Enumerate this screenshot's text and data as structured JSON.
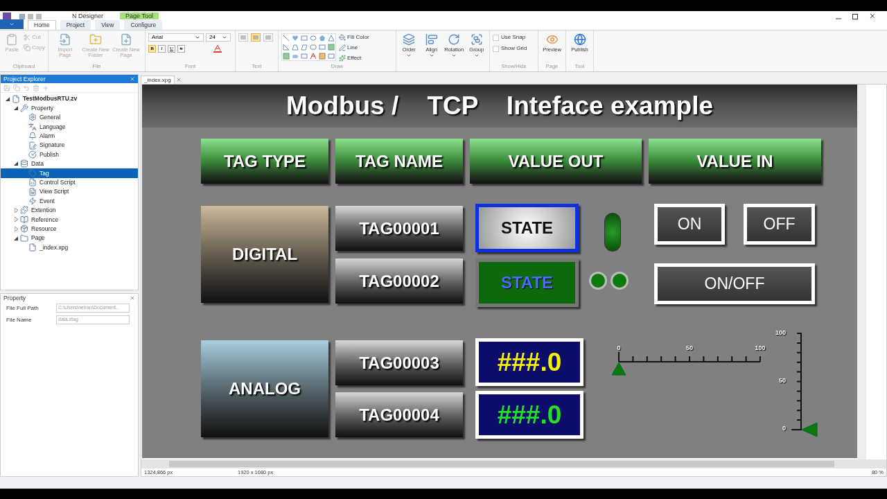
{
  "titlebar": {
    "app_title": "N Designer",
    "context_tab": "Page Tool"
  },
  "ribbon_tabs": [
    {
      "label": "Home",
      "selected": true
    },
    {
      "label": "Project",
      "selected": false
    },
    {
      "label": "View",
      "selected": false
    },
    {
      "label": "Configure",
      "selected": false
    }
  ],
  "ribbon": {
    "clipboard": {
      "label": "Clipboard",
      "paste": "Paste",
      "cut": "Cut",
      "copy": "Copy"
    },
    "file": {
      "label": "File",
      "buttons": [
        "Import Page",
        "Create New Folder",
        "Create New Page"
      ]
    },
    "font": {
      "label": "Font",
      "family": "Arial",
      "size": "24",
      "styles": [
        {
          "label": "B",
          "kind": "bold",
          "on": true
        },
        {
          "label": "I",
          "kind": "italic",
          "on": false
        },
        {
          "label": "U",
          "kind": "underline",
          "on": false
        },
        {
          "label": "S",
          "kind": "strike",
          "on": false
        }
      ]
    },
    "text": {
      "label": "Text",
      "alignments": [
        {
          "selected": false
        },
        {
          "selected": true
        },
        {
          "selected": false
        }
      ]
    },
    "draw": {
      "label": "Draw",
      "fill_color": "Fill Color",
      "line": "Line",
      "effect": "Effect"
    },
    "arrange": {
      "buttons": [
        "Order",
        "Align",
        "Rotation",
        "Group"
      ]
    },
    "show_hide": {
      "label": "Show/Hide",
      "options": [
        {
          "label": "Use Snap",
          "checked": false
        },
        {
          "label": "Show Grid",
          "checked": false
        }
      ]
    },
    "page": {
      "label": "Page",
      "button": "Preview"
    },
    "tool": {
      "label": "Tool",
      "button": "Publish"
    }
  },
  "project_explorer": {
    "title": "Project Explorer",
    "tree": [
      {
        "label": "TestModbusRTU.zv",
        "expanded": true,
        "selected": false,
        "children": [
          {
            "label": "Property",
            "expanded": true,
            "selected": false,
            "children": [
              {
                "label": "General",
                "selected": false
              },
              {
                "label": "Language",
                "selected": false
              },
              {
                "label": "Alarm",
                "selected": false
              },
              {
                "label": "Signature",
                "selected": false
              },
              {
                "label": "Publish",
                "selected": false
              }
            ]
          },
          {
            "label": "Data",
            "expanded": true,
            "selected": false,
            "children": [
              {
                "label": "Tag",
                "selected": true
              },
              {
                "label": "Control Script",
                "selected": false
              },
              {
                "label": "View Script",
                "selected": false
              },
              {
                "label": "Event",
                "selected": false
              }
            ]
          },
          {
            "label": "Extention",
            "expanded": false,
            "selected": false
          },
          {
            "label": "Reference",
            "expanded": false,
            "selected": false
          },
          {
            "label": "Resource",
            "expanded": false,
            "selected": false
          },
          {
            "label": "Page",
            "expanded": true,
            "selected": false,
            "children": [
              {
                "label": "_index.xpg",
                "selected": false
              }
            ]
          }
        ]
      }
    ]
  },
  "property_panel": {
    "title": "Property",
    "fields": [
      {
        "label": "File Full Path",
        "value": "C:\\Users\\netran\\Document...",
        "disabled": true
      },
      {
        "label": "File Name",
        "value": "data.ztag",
        "disabled": true
      }
    ]
  },
  "document_tab": "_index.xpg",
  "canvas": {
    "title": "Modbus /    TCP    Inteface example",
    "headers": [
      "TAG TYPE",
      "TAG NAME",
      "VALUE OUT",
      "VALUE IN"
    ],
    "digital": {
      "label": "DIGITAL",
      "tags": [
        "TAG00001",
        "TAG00002"
      ],
      "state_buttons": [
        {
          "label": "STATE",
          "kind": "push",
          "selected": true
        },
        {
          "label": "STATE",
          "kind": "lamp",
          "selected": false
        }
      ],
      "big_lamp_on": true,
      "small_lamps": [
        {
          "on": true
        },
        {
          "on": true
        }
      ],
      "switches": [
        "ON",
        "OFF",
        "ON/OFF"
      ]
    },
    "analog": {
      "label": "ANALOG",
      "tags": [
        "TAG00003",
        "TAG00004"
      ],
      "displays": [
        {
          "value": "###.0",
          "color": "#f5f200"
        },
        {
          "value": "###.0",
          "color": "#22e022"
        }
      ],
      "h_slider": {
        "ticks": [
          "0",
          "50",
          "100"
        ],
        "level": 0
      },
      "v_slider": {
        "ticks": [
          "100",
          "50",
          "0"
        ],
        "level": 0
      }
    }
  },
  "status_bar": {
    "cursor": "1324,866 px",
    "size": "1920 x 1080 px",
    "zoom": "80 %"
  }
}
